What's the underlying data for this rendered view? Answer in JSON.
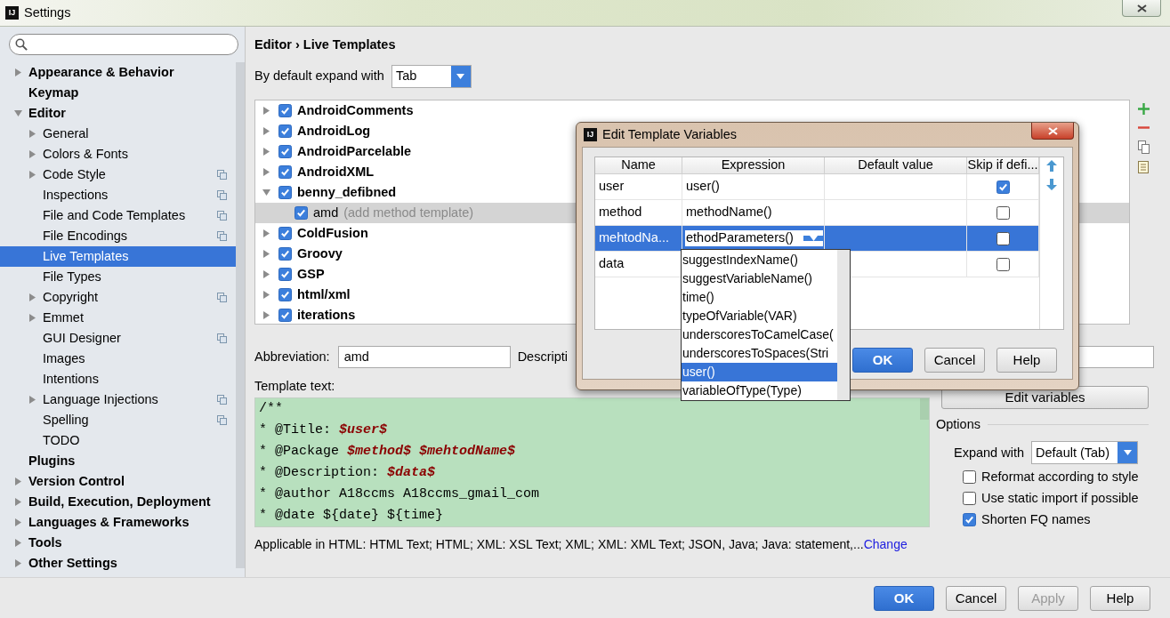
{
  "window": {
    "icon_text": "IJ",
    "title": "Settings"
  },
  "sidebar": {
    "items": [
      {
        "label": "Appearance & Behavior",
        "expanded": false,
        "shared": false,
        "selected": false
      },
      {
        "label": "Keymap",
        "shared": false,
        "selected": false
      },
      {
        "label": "Editor",
        "expanded": true,
        "shared": false,
        "selected": false,
        "children": [
          {
            "label": "General",
            "expanded": false,
            "shared": false,
            "selected": false
          },
          {
            "label": "Colors & Fonts",
            "expanded": false,
            "shared": false,
            "selected": false
          },
          {
            "label": "Code Style",
            "expanded": false,
            "shared": true,
            "selected": false
          },
          {
            "label": "Inspections",
            "shared": true,
            "selected": false
          },
          {
            "label": "File and Code Templates",
            "shared": true,
            "selected": false
          },
          {
            "label": "File Encodings",
            "shared": true,
            "selected": false
          },
          {
            "label": "Live Templates",
            "shared": false,
            "selected": true
          },
          {
            "label": "File Types",
            "shared": false,
            "selected": false
          },
          {
            "label": "Copyright",
            "expanded": false,
            "shared": true,
            "selected": false
          },
          {
            "label": "Emmet",
            "expanded": false,
            "shared": false,
            "selected": false
          },
          {
            "label": "GUI Designer",
            "shared": true,
            "selected": false
          },
          {
            "label": "Images",
            "shared": false,
            "selected": false
          },
          {
            "label": "Intentions",
            "shared": false,
            "selected": false
          },
          {
            "label": "Language Injections",
            "expanded": false,
            "shared": true,
            "selected": false
          },
          {
            "label": "Spelling",
            "shared": true,
            "selected": false
          },
          {
            "label": "TODO",
            "shared": false,
            "selected": false
          }
        ]
      },
      {
        "label": "Plugins",
        "shared": false,
        "selected": false
      },
      {
        "label": "Version Control",
        "expanded": false,
        "shared": false,
        "selected": false
      },
      {
        "label": "Build, Execution, Deployment",
        "expanded": false,
        "shared": false,
        "selected": false
      },
      {
        "label": "Languages & Frameworks",
        "expanded": false,
        "shared": false,
        "selected": false
      },
      {
        "label": "Tools",
        "expanded": false,
        "shared": false,
        "selected": false
      },
      {
        "label": "Other Settings",
        "expanded": false,
        "shared": false,
        "selected": false
      }
    ]
  },
  "breadcrumb": "Editor › Live Templates",
  "default_expand": {
    "label": "By default expand with",
    "value": "Tab"
  },
  "templates": [
    {
      "name": "AndroidComments",
      "checked": true,
      "expanded": false,
      "selected": false
    },
    {
      "name": "AndroidLog",
      "checked": true,
      "expanded": false,
      "selected": false
    },
    {
      "name": "AndroidParcelable",
      "checked": true,
      "expanded": false,
      "selected": false
    },
    {
      "name": "AndroidXML",
      "checked": true,
      "expanded": false,
      "selected": false
    },
    {
      "name": "benny_defibned",
      "checked": true,
      "expanded": true,
      "selected": false,
      "children": [
        {
          "name": "amd",
          "description": "(add method template)",
          "checked": true,
          "selected": true
        }
      ]
    },
    {
      "name": "ColdFusion",
      "checked": true,
      "expanded": false,
      "selected": false
    },
    {
      "name": "Groovy",
      "checked": true,
      "expanded": false,
      "selected": false
    },
    {
      "name": "GSP",
      "checked": true,
      "expanded": false,
      "selected": false
    },
    {
      "name": "html/xml",
      "checked": true,
      "expanded": false,
      "selected": false
    },
    {
      "name": "iterations",
      "checked": true,
      "expanded": false,
      "selected": false
    }
  ],
  "abbreviation": {
    "label": "Abbreviation:",
    "value": "amd"
  },
  "description": {
    "label": "Descripti"
  },
  "template_text": {
    "label": "Template text:",
    "lines": [
      "/**",
      "* @Title: **$user$**",
      "* @Package **$method$** **$mehtodName$**",
      "* @Description: **$data$**",
      "* @author A18ccms A18ccms_gmail_com",
      "* @date ${date} ${time}"
    ]
  },
  "applicable": {
    "text": "Applicable in HTML: HTML Text; HTML; XML: XSL Text; XML; XML: XML Text; JSON, Java; Java: statement,...",
    "link": "Change"
  },
  "edit_variables": "Edit variables",
  "options": {
    "title": "Options",
    "expand_with": {
      "label": "Expand with",
      "value": "Default (Tab)"
    },
    "checkboxes": [
      {
        "label": "Reformat according to style",
        "checked": false
      },
      {
        "label": "Use static import if possible",
        "checked": false
      },
      {
        "label": "Shorten FQ names",
        "checked": true
      }
    ]
  },
  "buttons": [
    {
      "label": "OK",
      "default": true,
      "disabled": false
    },
    {
      "label": "Cancel",
      "default": false,
      "disabled": false
    },
    {
      "label": "Apply",
      "default": false,
      "disabled": true
    },
    {
      "label": "Help",
      "default": false,
      "disabled": false
    }
  ],
  "dialog": {
    "icon_text": "IJ",
    "title": "Edit Template Variables",
    "columns": [
      "Name",
      "Expression",
      "Default value",
      "Skip if defi..."
    ],
    "rows": [
      {
        "name": "user",
        "expression": "user()",
        "skip": true,
        "selected": false,
        "editing": false
      },
      {
        "name": "method",
        "expression": "methodName()",
        "skip": false,
        "selected": false,
        "editing": false
      },
      {
        "name": "mehtodNa...",
        "expression": "ethodParameters()",
        "skip": false,
        "selected": true,
        "editing": true
      },
      {
        "name": "data",
        "skip": false,
        "selected": false,
        "editing": false
      }
    ],
    "suggestions": [
      {
        "text": "suggestIndexName()",
        "selected": false
      },
      {
        "text": "suggestVariableName()",
        "selected": false
      },
      {
        "text": "time()",
        "selected": false
      },
      {
        "text": "typeOfVariable(VAR)",
        "selected": false
      },
      {
        "text": "underscoresToCamelCase(",
        "selected": false
      },
      {
        "text": "underscoresToSpaces(Stri",
        "selected": false
      },
      {
        "text": "user()",
        "selected": true
      },
      {
        "text": "variableOfType(Type)",
        "selected": false
      }
    ],
    "buttons": [
      {
        "label": "OK",
        "default": true
      },
      {
        "label": "Cancel",
        "default": false
      },
      {
        "label": "Help",
        "default": false
      }
    ]
  }
}
